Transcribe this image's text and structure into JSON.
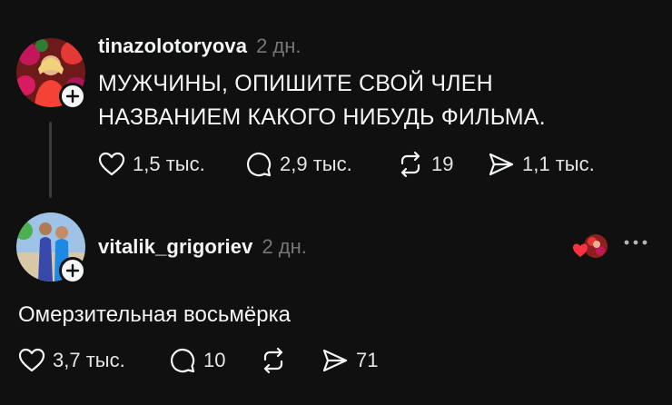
{
  "colors": {
    "background": "#101010",
    "text": "#f3f5f7",
    "muted": "#777777",
    "like_red": "#ff3040"
  },
  "post": {
    "username": "tinazolotoryova",
    "time": "2 дн.",
    "text_line1": "МУЖЧИНЫ, ОПИШИТЕ СВОЙ ЧЛЕН",
    "text_line2": "НАЗВАНИЕМ КАКОГО НИБУДЬ ФИЛЬМА.",
    "likes": "1,5 тыс.",
    "replies": "2,9 тыс.",
    "reposts": "19",
    "shares": "1,1 тыс."
  },
  "reply": {
    "username": "vitalik_grigoriev",
    "time": "2 дн.",
    "text": "Омерзительная восьмёрка",
    "likes": "3,7 тыс.",
    "replies": "10",
    "reposts": "",
    "shares": "71"
  },
  "icons": {
    "like": "heart-icon",
    "reply": "speech-bubble-icon",
    "repost": "repost-arrows-icon",
    "share": "paper-plane-icon",
    "follow": "plus-icon",
    "more": "ellipsis-icon",
    "liked_by_author": "heart-icon"
  }
}
